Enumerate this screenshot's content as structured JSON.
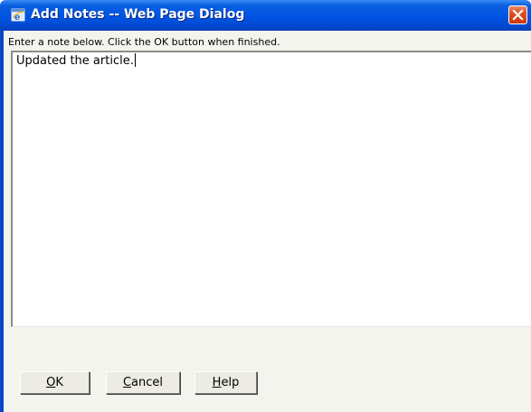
{
  "window": {
    "title": "Add Notes -- Web Page Dialog"
  },
  "icons": {
    "app": "internet-explorer-icon",
    "close": "close-icon"
  },
  "instructions": "Enter a note below. Click the OK button when finished.",
  "note": {
    "value": "Updated the article."
  },
  "buttons": {
    "ok": "OK",
    "cancel": "Cancel",
    "help": "Help"
  },
  "colors": {
    "titlebar": "#0054e3",
    "close": "#dd4d22",
    "dialog_bg": "#f4f4ee"
  }
}
